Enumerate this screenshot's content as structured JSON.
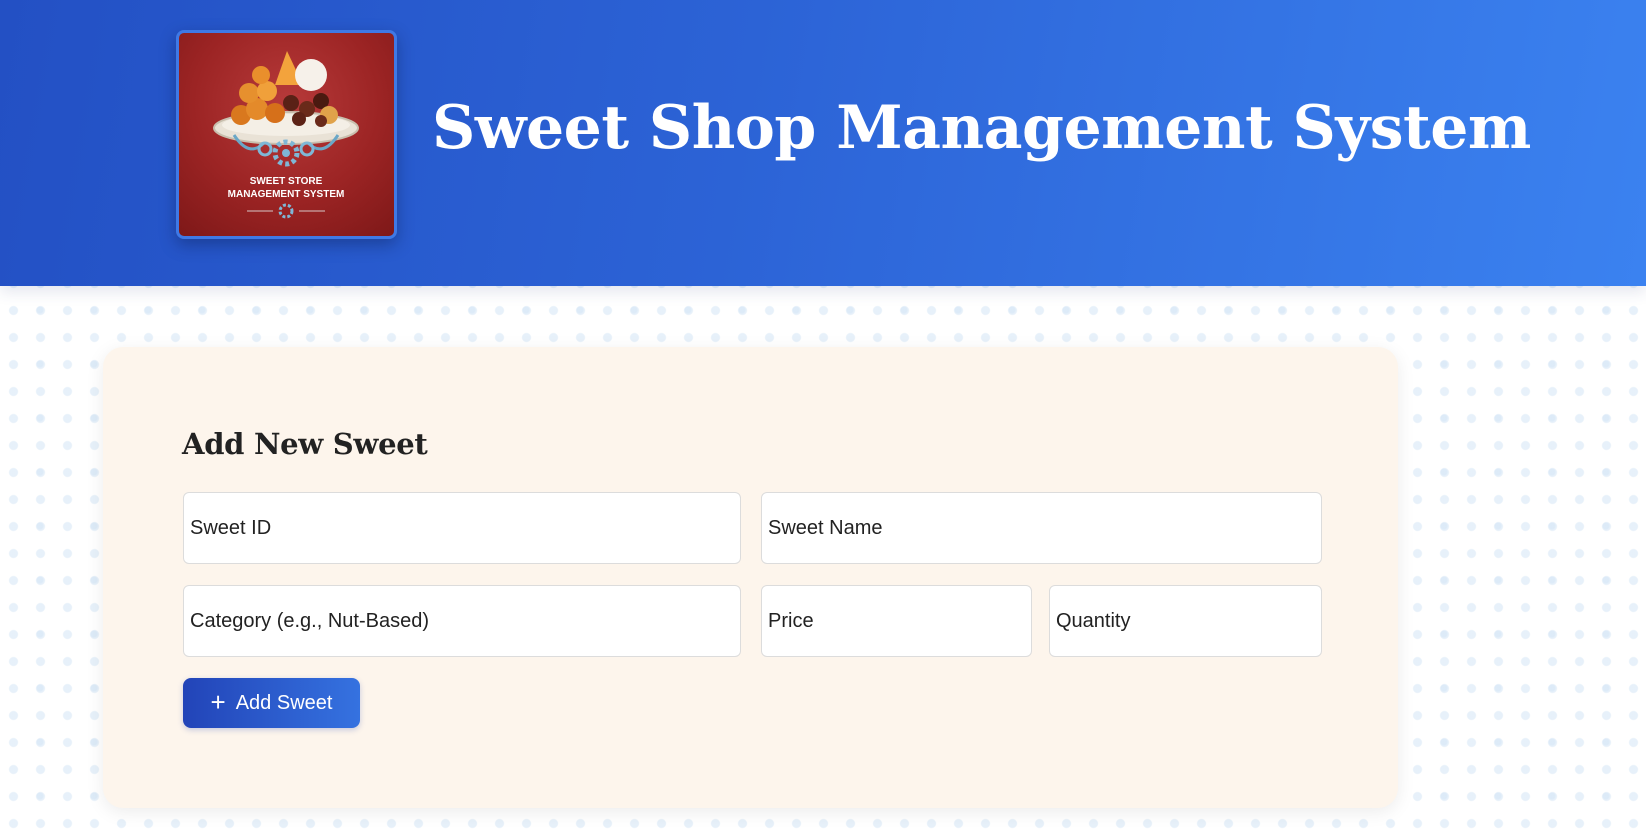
{
  "header": {
    "title": "Sweet Shop Management System",
    "logo": {
      "icon": "sweet-store-logo-image",
      "text_line1": "SWEET STORE",
      "text_line2": "MANAGEMENT SYSTEM"
    }
  },
  "form": {
    "heading": "Add New Sweet",
    "fields": {
      "sweet_id": {
        "placeholder": "Sweet ID",
        "value": ""
      },
      "sweet_name": {
        "placeholder": "Sweet Name",
        "value": ""
      },
      "category": {
        "placeholder": "Category (e.g., Nut-Based)",
        "value": ""
      },
      "price": {
        "placeholder": "Price",
        "value": ""
      },
      "quantity": {
        "placeholder": "Quantity",
        "value": ""
      }
    },
    "submit": {
      "icon": "plus-icon",
      "icon_glyph": "+",
      "label": "Add Sweet"
    }
  },
  "colors": {
    "header_start": "#2350c4",
    "header_end": "#3b82f0",
    "card_bg": "#fdf5ec",
    "button_start": "#2244b8",
    "button_end": "#3572e0"
  }
}
